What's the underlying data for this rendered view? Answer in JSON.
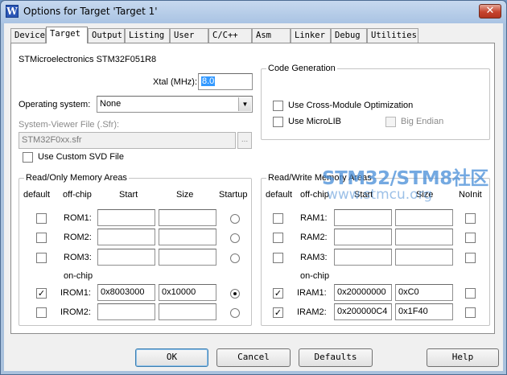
{
  "window": {
    "title": "Options for Target 'Target 1'",
    "close_glyph": "✕",
    "icon_letter": "W"
  },
  "tabs": [
    {
      "label": "Device",
      "active": false
    },
    {
      "label": "Target",
      "active": true
    },
    {
      "label": "Output",
      "active": false
    },
    {
      "label": "Listing",
      "active": false
    },
    {
      "label": "User",
      "active": false
    },
    {
      "label": "C/C++",
      "active": false
    },
    {
      "label": "Asm",
      "active": false
    },
    {
      "label": "Linker",
      "active": false
    },
    {
      "label": "Debug",
      "active": false
    },
    {
      "label": "Utilities",
      "active": false
    }
  ],
  "device": {
    "name": "STMicroelectronics STM32F051R8",
    "xtal_label": "Xtal (MHz):",
    "xtal_value": "8.0",
    "os_label": "Operating system:",
    "os_value": "None",
    "svf_label": "System-Viewer File (.Sfr):",
    "svf_value": "STM32F0xx.sfr",
    "browse_label": "...",
    "custom_svd_label": "Use Custom SVD File",
    "custom_svd_checked": false
  },
  "code_generation": {
    "title": "Code Generation",
    "cross_module_label": "Use Cross-Module Optimization",
    "cross_module_checked": false,
    "microlib_label": "Use MicroLIB",
    "microlib_checked": false,
    "big_endian_label": "Big Endian",
    "big_endian_checked": false
  },
  "rom": {
    "title": "Read/Only Memory Areas",
    "headers": {
      "default": "default",
      "offchip": "off-chip",
      "start": "Start",
      "size": "Size",
      "startup": "Startup"
    },
    "onchip_label": "on-chip",
    "rows": [
      {
        "name": "ROM1:",
        "default": false,
        "start": "",
        "size": "",
        "startup": false
      },
      {
        "name": "ROM2:",
        "default": false,
        "start": "",
        "size": "",
        "startup": false
      },
      {
        "name": "ROM3:",
        "default": false,
        "start": "",
        "size": "",
        "startup": false
      },
      {
        "name": "IROM1:",
        "default": true,
        "start": "0x8003000",
        "size": "0x10000",
        "startup": true
      },
      {
        "name": "IROM2:",
        "default": false,
        "start": "",
        "size": "",
        "startup": false
      }
    ]
  },
  "ram": {
    "title": "Read/Write Memory Areas",
    "headers": {
      "default": "default",
      "offchip": "off-chip",
      "start": "Start",
      "size": "Size",
      "noinit": "NoInit"
    },
    "onchip_label": "on-chip",
    "rows": [
      {
        "name": "RAM1:",
        "default": false,
        "start": "",
        "size": "",
        "noinit": false
      },
      {
        "name": "RAM2:",
        "default": false,
        "start": "",
        "size": "",
        "noinit": false
      },
      {
        "name": "RAM3:",
        "default": false,
        "start": "",
        "size": "",
        "noinit": false
      },
      {
        "name": "IRAM1:",
        "default": true,
        "start": "0x20000000",
        "size": "0xC0",
        "noinit": false
      },
      {
        "name": "IRAM2:",
        "default": true,
        "start": "0x200000C4",
        "size": "0x1F40",
        "noinit": false
      }
    ]
  },
  "buttons": {
    "ok": "OK",
    "cancel": "Cancel",
    "defaults": "Defaults",
    "help": "Help"
  },
  "watermark": {
    "line1": "STM32/STM8社区",
    "line2": "www.stmcu.org"
  },
  "glyphs": {
    "check": "✓",
    "dropdown": "▼"
  }
}
